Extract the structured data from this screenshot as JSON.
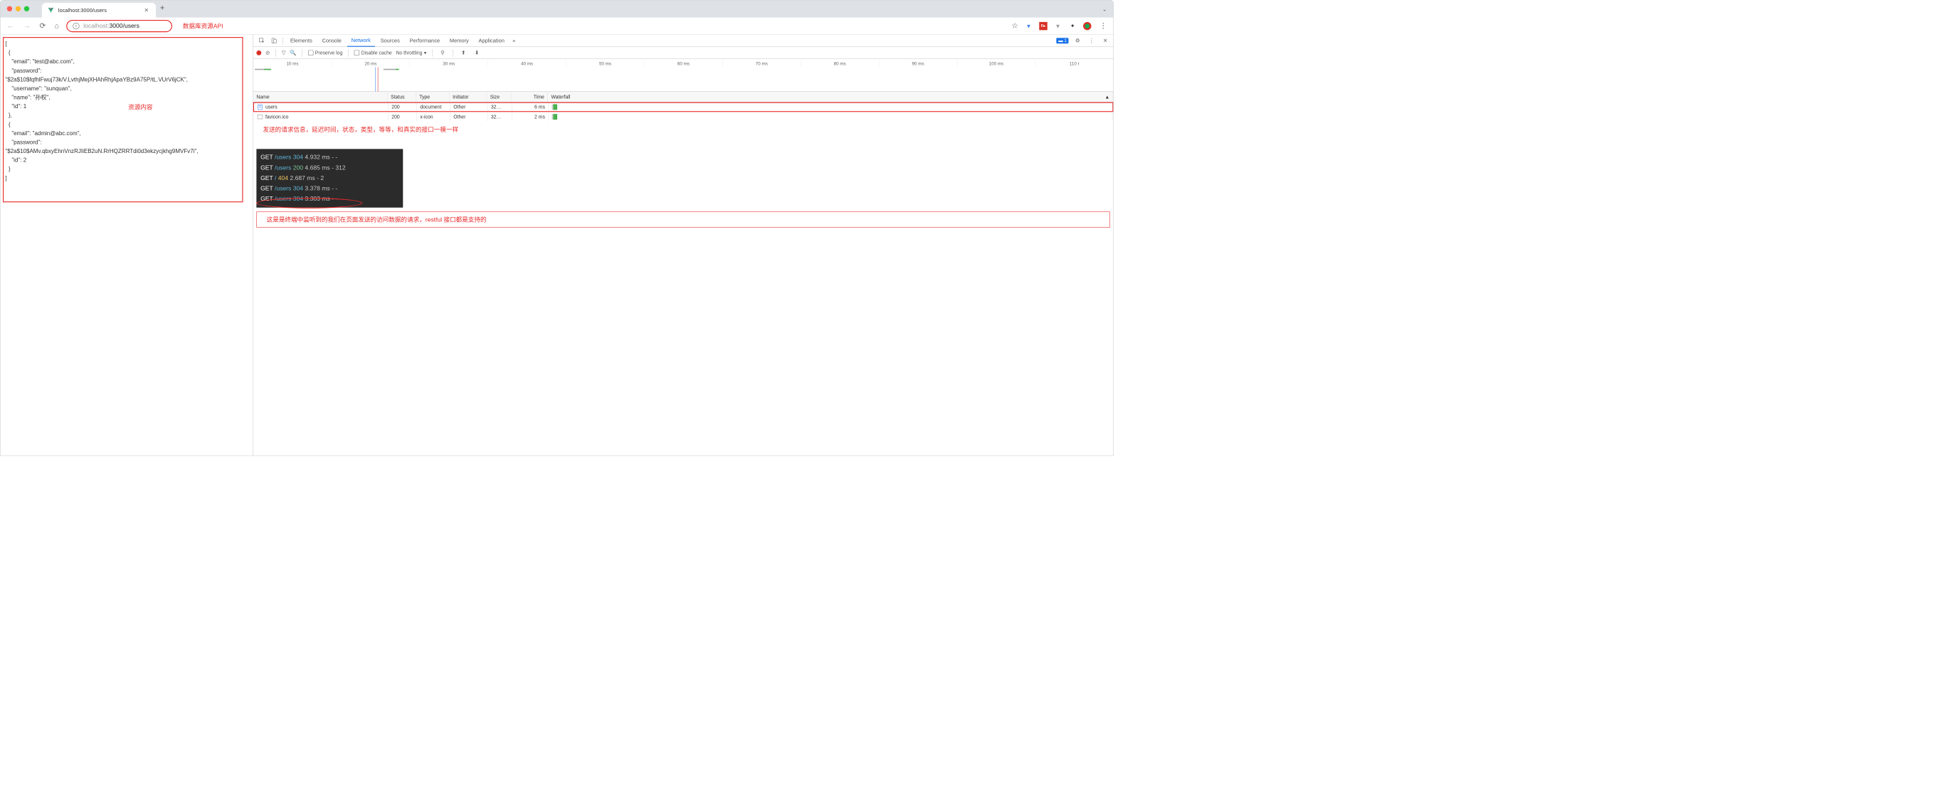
{
  "browser": {
    "tab_title": "localhost:3000/users",
    "url_host": "localhost:",
    "url_path": "3000/users",
    "url_annotation": "数据库资源API"
  },
  "json_response": "[\n  {\n    \"email\": \"test@abc.com\",\n    \"password\":\n\"$2a$10$fqfhlFwuj73k/V.LvthjMejXHAhRhjApaYBz9A75P/tL.VUrV6jCK\",\n    \"username\": \"sunquan\",\n    \"name\": \"孙权\",\n    \"id\": 1\n  },\n  {\n    \"email\": \"admin@abc.com\",\n    \"password\":\n\"$2a$10$AMv.qbxyEhnVnzRJIiEB2uN.RrHQZRRTdi0d3ekzycjkhg9MVFv7i\",\n    \"id\": 2\n  }\n]",
  "json_annotation": "资源内容",
  "devtools": {
    "tabs": [
      "Elements",
      "Console",
      "Network",
      "Sources",
      "Performance",
      "Memory",
      "Application"
    ],
    "active_tab": "Network",
    "badge_count": "1",
    "preserve_log": "Preserve log",
    "disable_cache": "Disable cache",
    "throttling": "No throttling",
    "time_ticks": [
      "10 ms",
      "20 ms",
      "30 ms",
      "40 ms",
      "50 ms",
      "60 ms",
      "70 ms",
      "80 ms",
      "90 ms",
      "100 ms",
      "110 r"
    ],
    "columns": {
      "name": "Name",
      "status": "Status",
      "type": "Type",
      "initiator": "Initiator",
      "size": "Size",
      "time": "Time",
      "waterfall": "Waterfall"
    },
    "rows": [
      {
        "name": "users",
        "status": "200",
        "type": "document",
        "initiator": "Other",
        "size": "32…",
        "time": "6 ms",
        "boxed": true,
        "icon": "doc"
      },
      {
        "name": "favicon.ico",
        "status": "200",
        "type": "x-icon",
        "initiator": "Other",
        "size": "32…",
        "time": "2 ms",
        "boxed": false,
        "icon": "img"
      }
    ],
    "row_annotation": "发送的请求信息，延迟时间，状态，类型，等等，和真实的接口一模一样"
  },
  "terminal": {
    "lines": [
      {
        "method": "GET",
        "path": "/users",
        "status": "304",
        "status_class": "t-304",
        "rest": "4.932 ms - -"
      },
      {
        "method": "GET",
        "path": "/users",
        "status": "200",
        "status_class": "t-200",
        "rest": "4.685 ms - 312"
      },
      {
        "method": "GET",
        "path": "/",
        "status": "404",
        "status_class": "t-404",
        "rest": "2.687 ms - 2"
      },
      {
        "method": "GET",
        "path": "/users",
        "status": "304",
        "status_class": "t-304",
        "rest": "3.378 ms - -"
      },
      {
        "method": "GET",
        "path": "/users",
        "status": "304",
        "status_class": "t-304",
        "rest": "3.303 ms - -"
      }
    ],
    "annotation": "这是是终端中监听到的我们在页面发送的访问数据的请求，restful 接口都是支持的"
  }
}
